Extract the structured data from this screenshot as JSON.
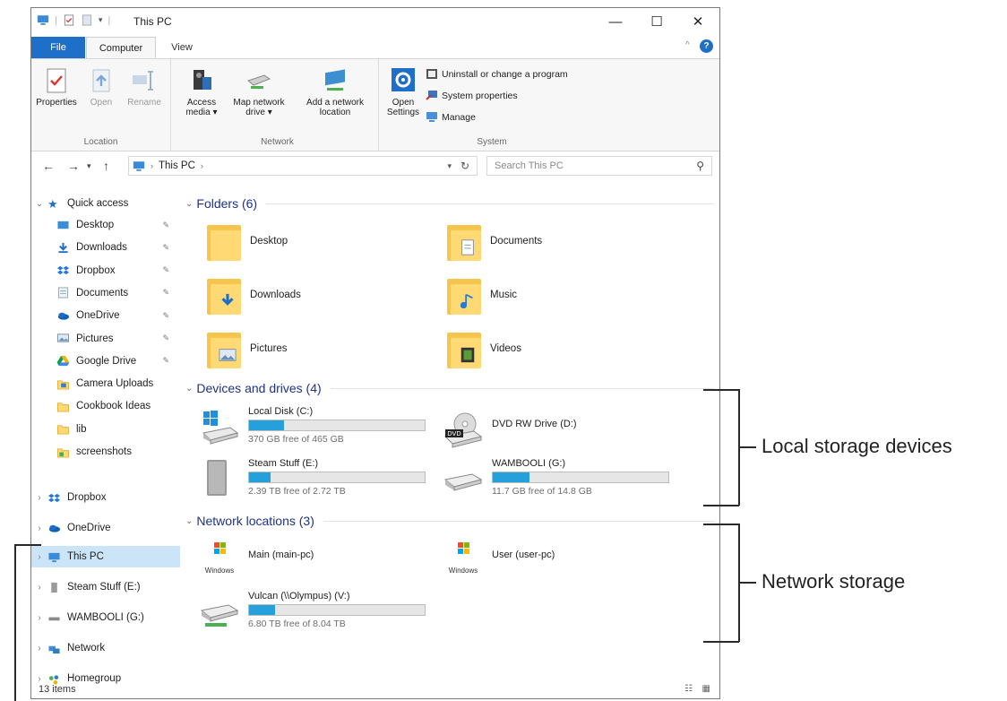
{
  "window": {
    "title": "This PC",
    "controls": {
      "minimize": "—",
      "maximize": "☐",
      "close": "✕"
    }
  },
  "ribbon": {
    "tabs": [
      "File",
      "Computer",
      "View"
    ],
    "groups": {
      "location": {
        "label": "Location",
        "buttons": [
          "Properties",
          "Open",
          "Rename"
        ]
      },
      "network": {
        "label": "Network",
        "buttons": [
          "Access\nmedia ▾",
          "Map network\ndrive ▾",
          "Add a network\nlocation"
        ]
      },
      "system": {
        "label": "System",
        "open_settings": "Open\nSettings",
        "items": [
          "Uninstall or change a program",
          "System properties",
          "Manage"
        ]
      }
    }
  },
  "address": {
    "path": "This PC",
    "search_placeholder": "Search This PC"
  },
  "nav": {
    "quick_access": "Quick access",
    "quick_items": [
      {
        "label": "Desktop",
        "pinned": true
      },
      {
        "label": "Downloads",
        "pinned": true
      },
      {
        "label": "Dropbox",
        "pinned": true
      },
      {
        "label": "Documents",
        "pinned": true
      },
      {
        "label": "OneDrive",
        "pinned": true
      },
      {
        "label": "Pictures",
        "pinned": true
      },
      {
        "label": "Google Drive",
        "pinned": true
      },
      {
        "label": "Camera Uploads",
        "pinned": false
      },
      {
        "label": "Cookbook Ideas",
        "pinned": false
      },
      {
        "label": "lib",
        "pinned": false
      },
      {
        "label": "screenshots",
        "pinned": false
      }
    ],
    "roots": [
      "Dropbox",
      "OneDrive",
      "This PC",
      "Steam Stuff (E:)",
      "WAMBOOLI (G:)",
      "Network",
      "Homegroup"
    ]
  },
  "content": {
    "folders_header": "Folders (6)",
    "folders": [
      "Desktop",
      "Documents",
      "Downloads",
      "Music",
      "Pictures",
      "Videos"
    ],
    "drives_header": "Devices and drives (4)",
    "drives": [
      {
        "name": "Local Disk (C:)",
        "free": "370 GB free of 465 GB",
        "used_fraction": 0.2
      },
      {
        "name": "DVD RW Drive (D:)"
      },
      {
        "name": "Steam Stuff (E:)",
        "free": "2.39 TB free of 2.72 TB",
        "used_fraction": 0.12
      },
      {
        "name": "WAMBOOLI (G:)",
        "free": "11.7 GB free of 14.8 GB",
        "used_fraction": 0.21
      }
    ],
    "network_header": "Network locations (3)",
    "network": [
      {
        "name": "Main (main-pc)"
      },
      {
        "name": "User (user-pc)"
      },
      {
        "name": "Vulcan (\\\\Olympus) (V:)",
        "free": "6.80 TB free of 8.04 TB",
        "used_fraction": 0.15
      }
    ],
    "wmp_label": "Windows"
  },
  "status": {
    "items": "13 items"
  },
  "annotations": {
    "local": "Local storage devices",
    "network": "Network storage"
  },
  "colors": {
    "accent": "#1e6fc8",
    "bar": "#26a0da",
    "selected": "#cce4f7",
    "header": "#1e3287"
  }
}
